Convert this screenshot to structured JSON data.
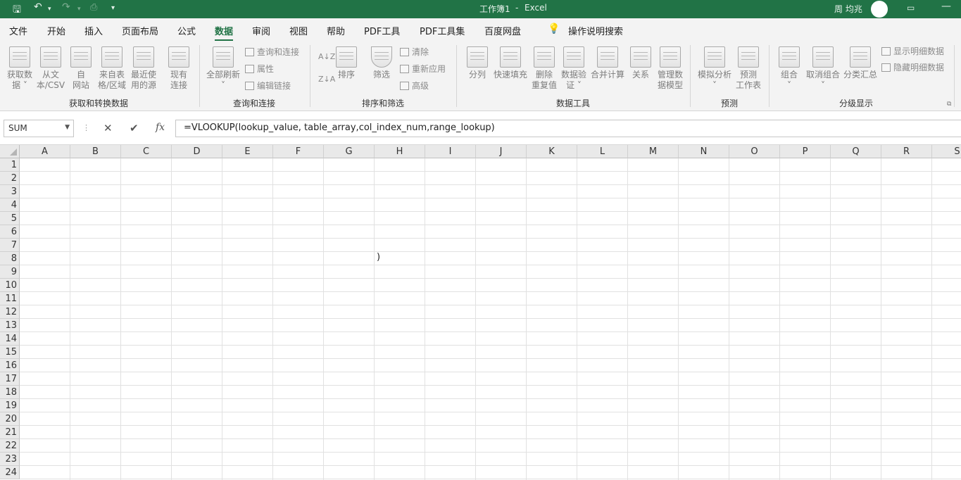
{
  "titlebar": {
    "doc": "工作簿1",
    "sep": "-",
    "app": "Excel",
    "user": "周 均兆"
  },
  "tabs": [
    "文件",
    "开始",
    "插入",
    "页面布局",
    "公式",
    "数据",
    "审阅",
    "视图",
    "帮助",
    "PDF工具",
    "PDF工具集",
    "百度网盘"
  ],
  "active_tab": "数据",
  "search_label": "操作说明搜索",
  "ribbon": {
    "get_data": {
      "l1": "获取数",
      "l2": "据"
    },
    "from_text": {
      "l1": "从文",
      "l2": "本/CSV"
    },
    "from_web": {
      "l1": "自",
      "l2": "网站"
    },
    "from_table": {
      "l1": "来自表",
      "l2": "格/区域"
    },
    "recent": {
      "l1": "最近使",
      "l2": "用的源"
    },
    "existing": {
      "l1": "现有",
      "l2": "连接"
    },
    "refresh_all": {
      "l1": "全部刷新"
    },
    "queries": "查询和连接",
    "properties": "属性",
    "edit_links": "编辑链接",
    "sort": "排序",
    "filter": "筛选",
    "clear": "清除",
    "reapply": "重新应用",
    "advanced": "高级",
    "text_to_col": "分列",
    "flash_fill": "快速填充",
    "remove_dup": {
      "l1": "删除",
      "l2": "重复值"
    },
    "validation": {
      "l1": "数据验",
      "l2": "证"
    },
    "consolidate": "合并计算",
    "relations": "关系",
    "data_model": {
      "l1": "管理数",
      "l2": "据模型"
    },
    "what_if": "模拟分析",
    "forecast": {
      "l1": "预测",
      "l2": "工作表"
    },
    "group": "组合",
    "ungroup": "取消组合",
    "subtotal": "分类汇总",
    "show_detail": "显示明细数据",
    "hide_detail": "隐藏明细数据",
    "groups": {
      "get_transform": "获取和转换数据",
      "query_conn": "查询和连接",
      "sort_filter": "排序和筛选",
      "data_tools": "数据工具",
      "forecast": "预测",
      "outline": "分级显示"
    }
  },
  "formula_bar": {
    "name_box": "SUM",
    "cancel": "✕",
    "enter": "✔",
    "fx": "fx",
    "formula": "=VLOOKUP(lookup_value, table_array,col_index_num,range_lookup)"
  },
  "grid": {
    "columns": [
      "A",
      "B",
      "C",
      "D",
      "E",
      "F",
      "G",
      "H",
      "I",
      "J",
      "K",
      "L",
      "M",
      "N",
      "O",
      "P",
      "Q",
      "R",
      "S"
    ],
    "rows": [
      "1",
      "2",
      "3",
      "4",
      "5",
      "6",
      "7",
      "8",
      "9",
      "10",
      "11",
      "12",
      "13",
      "14",
      "15",
      "16",
      "17",
      "18",
      "19",
      "20",
      "21",
      "22",
      "23",
      "24"
    ],
    "cell_H8": ")"
  }
}
